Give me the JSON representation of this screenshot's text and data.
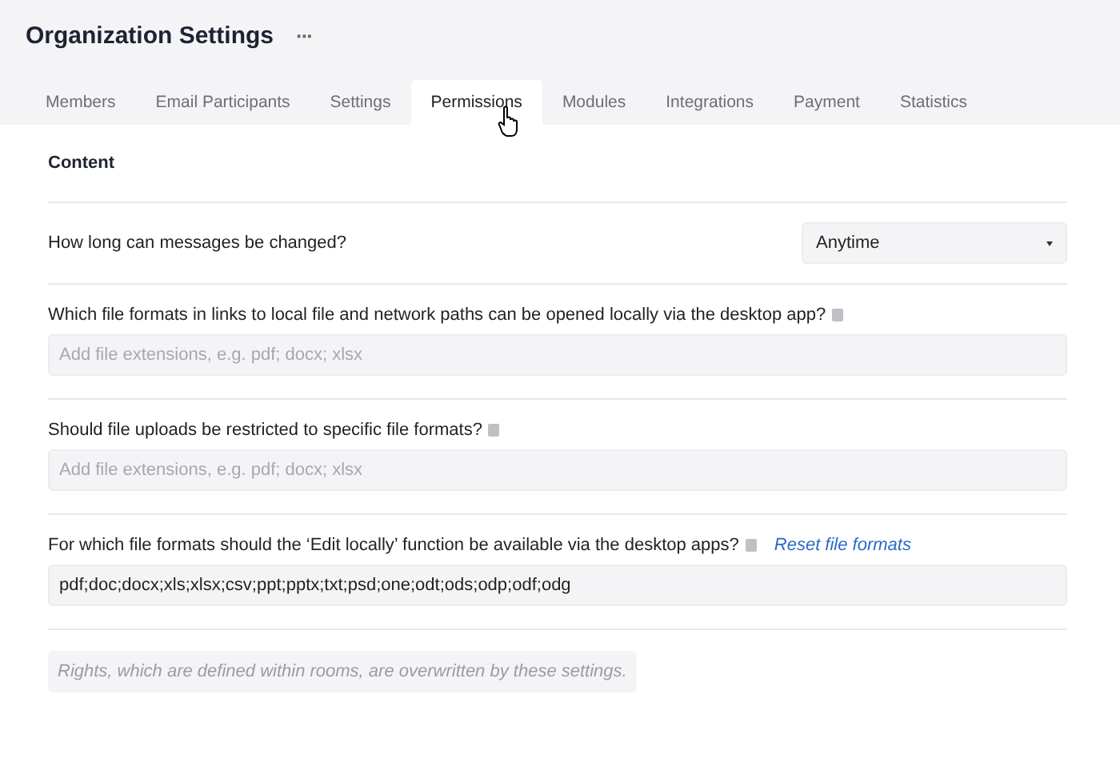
{
  "header": {
    "title": "Organization Settings",
    "more": "···"
  },
  "tabs": [
    {
      "label": "Members",
      "selected": false
    },
    {
      "label": "Email Participants",
      "selected": false
    },
    {
      "label": "Settings",
      "selected": false
    },
    {
      "label": "Permissions",
      "selected": true
    },
    {
      "label": "Modules",
      "selected": false
    },
    {
      "label": "Integrations",
      "selected": false
    },
    {
      "label": "Payment",
      "selected": false
    },
    {
      "label": "Statistics",
      "selected": false
    }
  ],
  "section": {
    "title": "Content"
  },
  "settings": [
    {
      "kind": "select",
      "label": "How long can messages be changed?",
      "value": "Anytime",
      "info": false
    },
    {
      "kind": "input",
      "label": "Which file formats in links to local file and network paths can be opened locally via the desktop app?",
      "info": true,
      "placeholder": "Add file extensions, e.g. pdf; docx; xlsx"
    },
    {
      "kind": "input",
      "label": "Should file uploads be restricted to specific file formats?",
      "info": true,
      "placeholder": "Add file extensions, e.g. pdf; docx; xlsx"
    },
    {
      "kind": "input",
      "label": "For which file formats should the ‘Edit locally’ function be available via the desktop apps?",
      "info": true,
      "link": "Reset file formats",
      "value": "pdf;doc;docx;xls;xlsx;csv;ppt;pptx;txt;psd;one;odt;ods;odp;odf;odg"
    }
  ],
  "note": "Rights, which are defined within rooms, are overwritten by these settings."
}
